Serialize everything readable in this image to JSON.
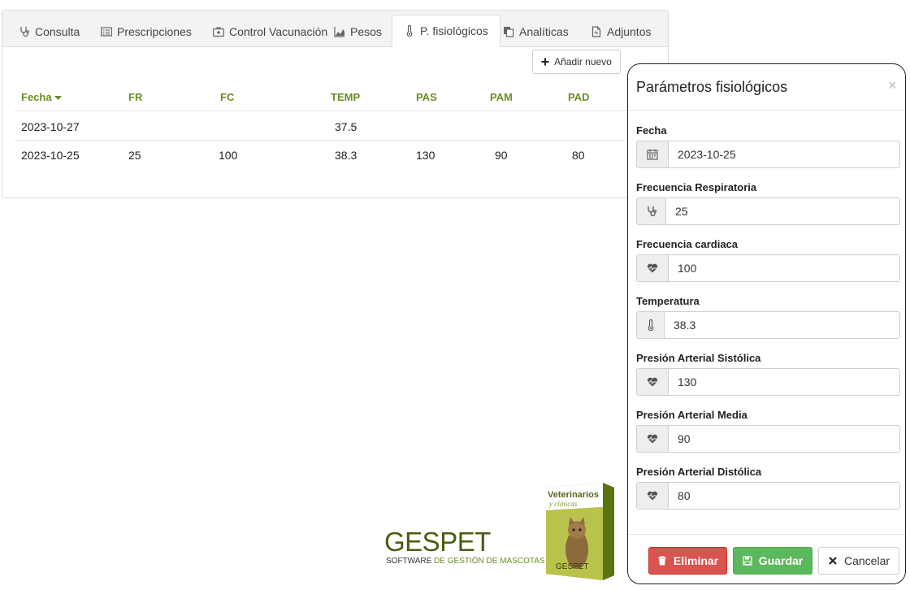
{
  "tabs": [
    {
      "label": "Consulta",
      "icon": "stethoscope-icon"
    },
    {
      "label": "Prescripciones",
      "icon": "list-alt-icon"
    },
    {
      "label": "Control Vacunación",
      "icon": "medkit-icon"
    },
    {
      "label": "Pesos",
      "icon": "area-chart-icon"
    },
    {
      "label": "P. fisiológicos",
      "icon": "thermometer-icon"
    },
    {
      "label": "Analíticas",
      "icon": "copy-icon"
    },
    {
      "label": "Adjuntos",
      "icon": "file-icon"
    }
  ],
  "active_tab": "P. fisiológicos",
  "toolbar": {
    "add_label": "Añadir nuevo"
  },
  "table": {
    "columns": [
      "Fecha",
      "FR",
      "FC",
      "TEMP",
      "PAS",
      "PAM",
      "PAD"
    ],
    "sort_column": "Fecha",
    "rows": [
      [
        "2023-10-27",
        "",
        "",
        "37.5",
        "",
        "",
        ""
      ],
      [
        "2023-10-25",
        "25",
        "100",
        "38.3",
        "130",
        "90",
        "80"
      ]
    ]
  },
  "logo": {
    "brand_a": "GES",
    "brand_b": "PET",
    "sub_a": "SOFTWARE ",
    "sub_b": "DE GESTIÓN DE MASCOTAS",
    "box_line1": "Veterinarios",
    "box_line2": "y clínicas",
    "box_brand": "GESPET"
  },
  "modal": {
    "title": "Parámetros fisiológicos",
    "close": "×",
    "fields": [
      {
        "label": "Fecha",
        "value": "2023-10-25",
        "icon": "calendar-icon"
      },
      {
        "label": "Frecuencia Respiratoria",
        "value": "25",
        "icon": "stethoscope-icon"
      },
      {
        "label": "Frecuencia cardiaca",
        "value": "100",
        "icon": "heartbeat-icon"
      },
      {
        "label": "Temperatura",
        "value": "38.3",
        "icon": "thermometer-icon"
      },
      {
        "label": "Presión Arterial Sistólica",
        "value": "130",
        "icon": "heartbeat-icon"
      },
      {
        "label": "Presión Arterial Media",
        "value": "90",
        "icon": "heartbeat-icon"
      },
      {
        "label": "Presión Arterial Distólica",
        "value": "80",
        "icon": "heartbeat-icon"
      }
    ],
    "buttons": {
      "delete": "Eliminar",
      "save": "Guardar",
      "cancel": "Cancelar"
    }
  },
  "colors": {
    "header_green": "#6b8e23",
    "danger": "#d9534f",
    "success": "#5cb85c"
  }
}
